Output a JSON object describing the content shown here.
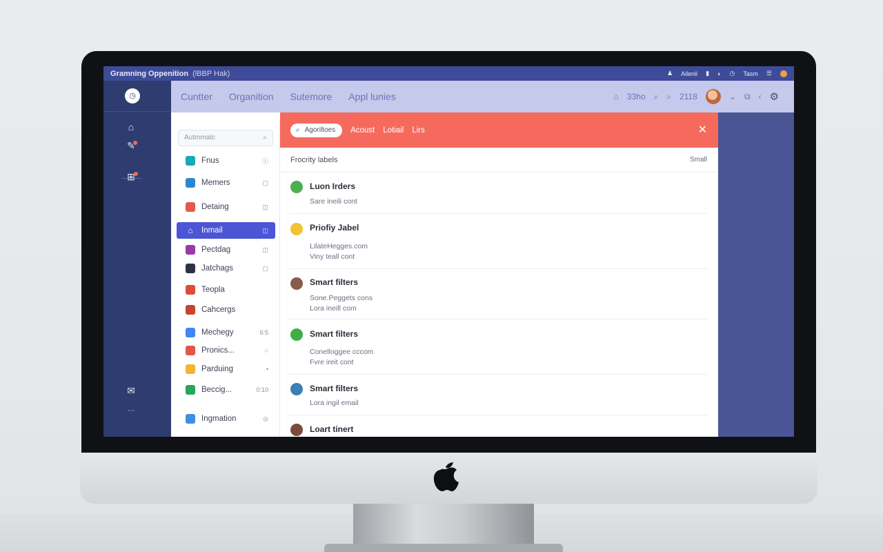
{
  "menubar": {
    "title": "Gramning Oppenition",
    "extra": "(lBBP Hak)",
    "right_items": [
      "Ailenii",
      "Tasm"
    ]
  },
  "topnav": {
    "items": [
      "Cuntter",
      "Organition",
      "Sutemore",
      "Appl lunies"
    ],
    "right_a": "33ho",
    "right_b": "2118"
  },
  "sidebar": {
    "search_placeholder": "Autmmatc",
    "items": [
      {
        "label": "Fnus",
        "end": "ⓘ",
        "color": "#19a9b5"
      },
      {
        "label": "Memers",
        "end": "▢",
        "color": "#2b87d1"
      },
      {
        "label": "Detaing",
        "end": "◫",
        "color": "#e25a4c"
      },
      {
        "label": "Inmail",
        "end": "◫",
        "color": "#ffffff"
      },
      {
        "label": "Pectdag",
        "end": "◫",
        "color": "#9a39a8"
      },
      {
        "label": "Jatchags",
        "end": "▢",
        "color": "#2d3346"
      },
      {
        "label": "Teopla",
        "end": "",
        "color": "#e04a3a"
      },
      {
        "label": "Cahcergs",
        "end": "",
        "color": "#c9442e"
      },
      {
        "label": "Mechegy",
        "end": "6:5",
        "color": "#4285f4"
      },
      {
        "label": "Pronics...",
        "end": "○",
        "color": "#e2574c"
      },
      {
        "label": "Parduing",
        "end": "•",
        "color": "#f2b531"
      },
      {
        "label": "Beccig...",
        "end": "0:10",
        "color": "#26a560"
      },
      {
        "label": "Ingmation",
        "end": "◎",
        "color": "#3e8fe0"
      }
    ]
  },
  "mail": {
    "pill": "Agoriltoes",
    "tabs": [
      "Acoust",
      "Lotiail",
      "Lirs"
    ],
    "sub_label": "Frocrity labels",
    "sub_right": "Small",
    "messages": [
      {
        "title": "Luon Irders",
        "lines": [
          "Sare ineili cont"
        ],
        "color": "#4cb050"
      },
      {
        "title": "Priofiy Jabel",
        "lines": [
          "LilateHegges.com",
          "Viny teall cont"
        ],
        "color": "#f1c232"
      },
      {
        "title": "Smart filters",
        "lines": [
          "Sone.Peggets cons",
          "Lora ineill com"
        ],
        "color": "#8a5a4a"
      },
      {
        "title": "Smart filters",
        "lines": [
          "Conelloggee cccom",
          "Fvre ireit cont"
        ],
        "color": "#3fae49"
      },
      {
        "title": "Smart filters",
        "lines": [
          "Lora ingil email"
        ],
        "color": "#3a7fb5"
      },
      {
        "title": "Loart tinert",
        "lines": [],
        "color": "#7a4b3e"
      }
    ]
  }
}
